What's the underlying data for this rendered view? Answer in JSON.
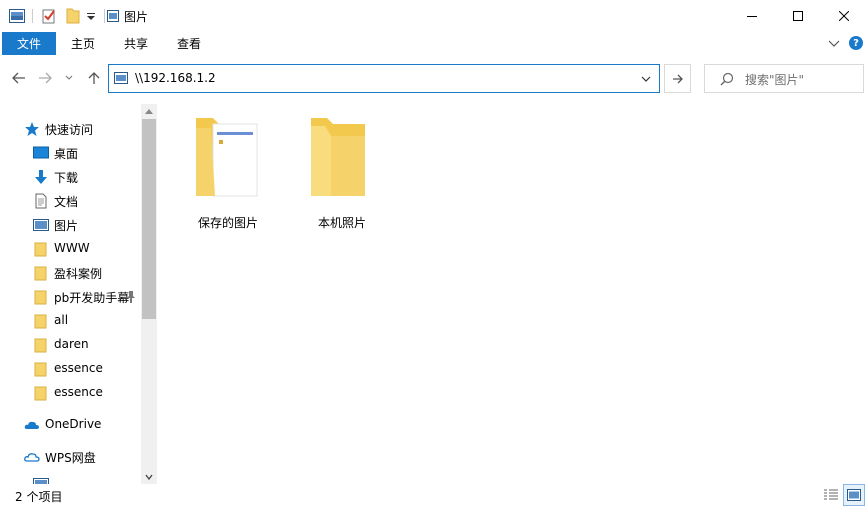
{
  "window": {
    "title": "图片"
  },
  "ribbon": {
    "tabs": [
      "文件",
      "主页",
      "共享",
      "查看"
    ],
    "help_label": "?"
  },
  "address": {
    "path": "\\\\192.168.1.2"
  },
  "search": {
    "placeholder": "搜索\"图片\""
  },
  "navpane": {
    "quick_access": "快速访问",
    "items": [
      {
        "label": "桌面",
        "icon": "desktop-icon",
        "pinned": true
      },
      {
        "label": "下载",
        "icon": "download-icon",
        "pinned": true
      },
      {
        "label": "文档",
        "icon": "document-icon",
        "pinned": true
      },
      {
        "label": "图片",
        "icon": "pictures-icon",
        "pinned": true
      },
      {
        "label": "WWW",
        "icon": "folder-icon",
        "pinned": true
      },
      {
        "label": "盈科案例",
        "icon": "folder-icon",
        "pinned": true
      },
      {
        "label": "pb开发助手幕",
        "icon": "folder-icon",
        "pinned": true
      },
      {
        "label": "all",
        "icon": "folder-icon",
        "pinned": false
      },
      {
        "label": "daren",
        "icon": "folder-icon",
        "pinned": false
      },
      {
        "label": "essence",
        "icon": "folder-icon",
        "pinned": false
      },
      {
        "label": "essence",
        "icon": "folder-icon",
        "pinned": false
      }
    ],
    "onedrive": "OneDrive",
    "wps": "WPS网盘"
  },
  "content": {
    "folders": [
      {
        "label": "保存的图片",
        "icon": "folder-with-document-icon"
      },
      {
        "label": "本机照片",
        "icon": "folder-icon"
      }
    ]
  },
  "status": {
    "item_count": "2 个项目"
  },
  "colors": {
    "accent": "#1979ca",
    "folder": "#f6d36a"
  }
}
